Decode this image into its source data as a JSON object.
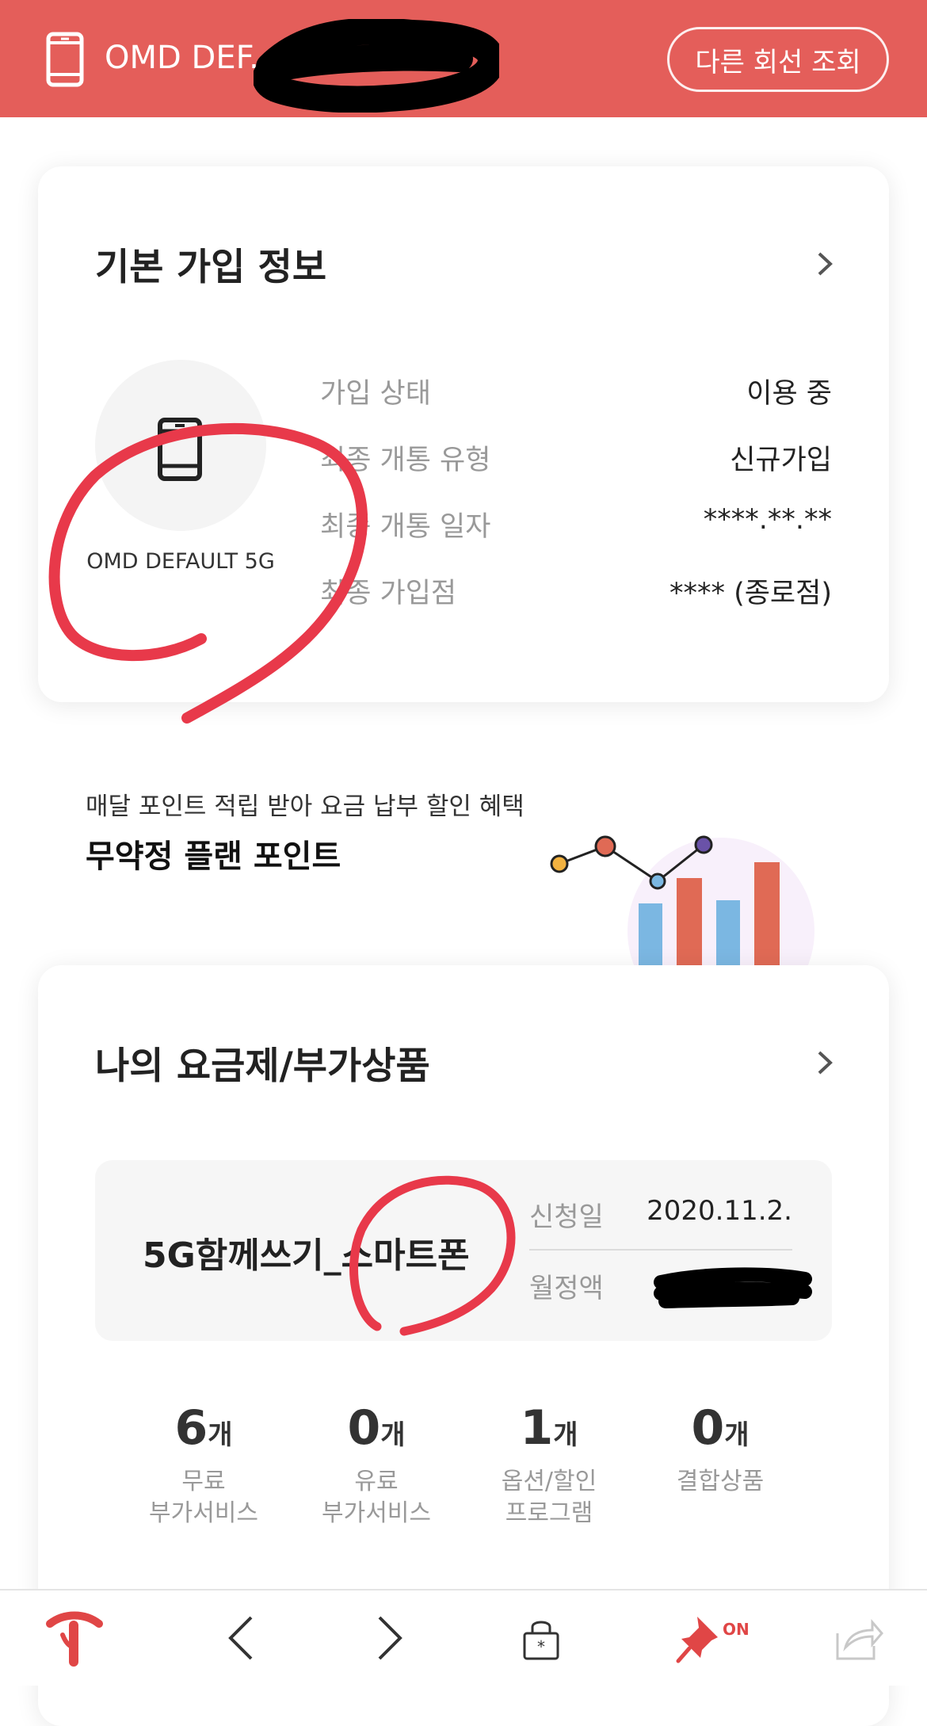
{
  "header": {
    "line_label": "OMD DEF.",
    "other_line_button": "다른 회선 조회",
    "bg_color": "#e45e5a"
  },
  "subscription": {
    "title": "기본 가입 정보",
    "device_name": "OMD DEFAULT 5G",
    "rows": [
      {
        "label": "가입 상태",
        "value": "이용 중"
      },
      {
        "label": "최종 개통 유형",
        "value": "신규가입"
      },
      {
        "label": "최종 개통 일자",
        "value": "****.**.**"
      },
      {
        "label": "최종 가입점",
        "value": "**** (종로점)"
      }
    ]
  },
  "promo": {
    "subtitle": "매달 포인트 적립 받아 요금 납부 할인 혜택",
    "title": "무약정 플랜 포인트"
  },
  "plan": {
    "title": "나의 요금제/부가상품",
    "plan_name": "5G함께쓰기_스마트폰",
    "apply_date_label": "신청일",
    "apply_date_value": "2020.11.2.",
    "monthly_fee_label": "월정액",
    "stats": [
      {
        "count": "6",
        "unit": "개",
        "label_line1": "무료",
        "label_line2": "부가서비스"
      },
      {
        "count": "0",
        "unit": "개",
        "label_line1": "유료",
        "label_line2": "부가서비스"
      },
      {
        "count": "1",
        "unit": "개",
        "label_line1": "옵션/할인",
        "label_line2": "프로그램"
      },
      {
        "count": "0",
        "unit": "개",
        "label_line1": "",
        "label_line2": "결합상품"
      }
    ]
  },
  "bottom_bar": {
    "items": [
      "t-logo-icon",
      "back-arrow-icon",
      "forward-arrow-icon",
      "lock-icon",
      "pin-icon",
      "share-icon"
    ],
    "pin_status": "ON",
    "accent": "#e04646"
  },
  "annotation_color": "#e8394a"
}
